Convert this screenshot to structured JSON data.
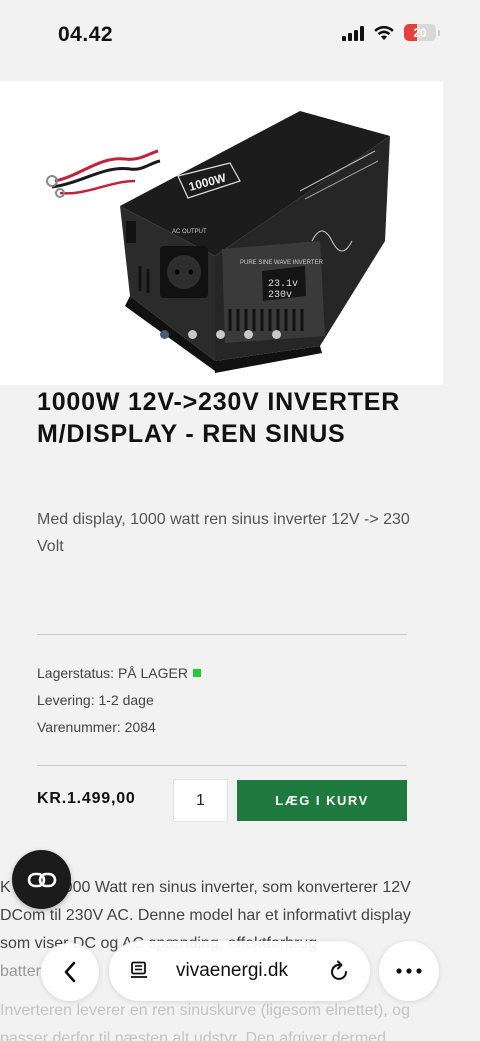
{
  "status_bar": {
    "time": "04.42",
    "battery_level": "20",
    "battery_color": "#e5403a"
  },
  "product": {
    "image_icon": "inverter-photo",
    "carousel": {
      "count": 5,
      "active_index": 0
    },
    "title": "1000W 12V->230V INVERTER M/DISPLAY - REN SINUS",
    "short_description": "Med display, 1000 watt ren sinus inverter 12V -> 230 Volt",
    "stock_label": "Lagerstatus: PÅ LAGER",
    "stock_color": "#22cc33",
    "delivery_label": "Levering: 1-2 dage",
    "sku_label": "Varenummer: 2084",
    "price": "KR.1.499,00",
    "quantity": "1",
    "add_to_cart_label": "LÆG I KURV",
    "button_color": "#1f7a3f",
    "description": {
      "p1_a": "K",
      "p1_b": "000 Watt ren sinus inverter, som konverterer 12V",
      "p1_c": "DC ",
      "p1_d": "om til 230V AC. Denne model har et informativt display",
      "p1_e": "som viser DC og AC spænding, effektforbrug",
      "p1_f": "batter",
      "p1_g": "m.",
      "p2_a": "Inverteren leverer en ren sinuskurve (ligesom elnettet), og",
      "p2_b": "passer derfor til næsten alt udstyr. Den afgiver dermed"
    }
  },
  "browser": {
    "url": "vivaenergi.dk",
    "back_icon": "chevron-left-icon",
    "more_icon": "ellipsis-icon",
    "reader_icon": "reader-icon",
    "reload_icon": "reload-icon",
    "link_icon": "link-icon"
  }
}
